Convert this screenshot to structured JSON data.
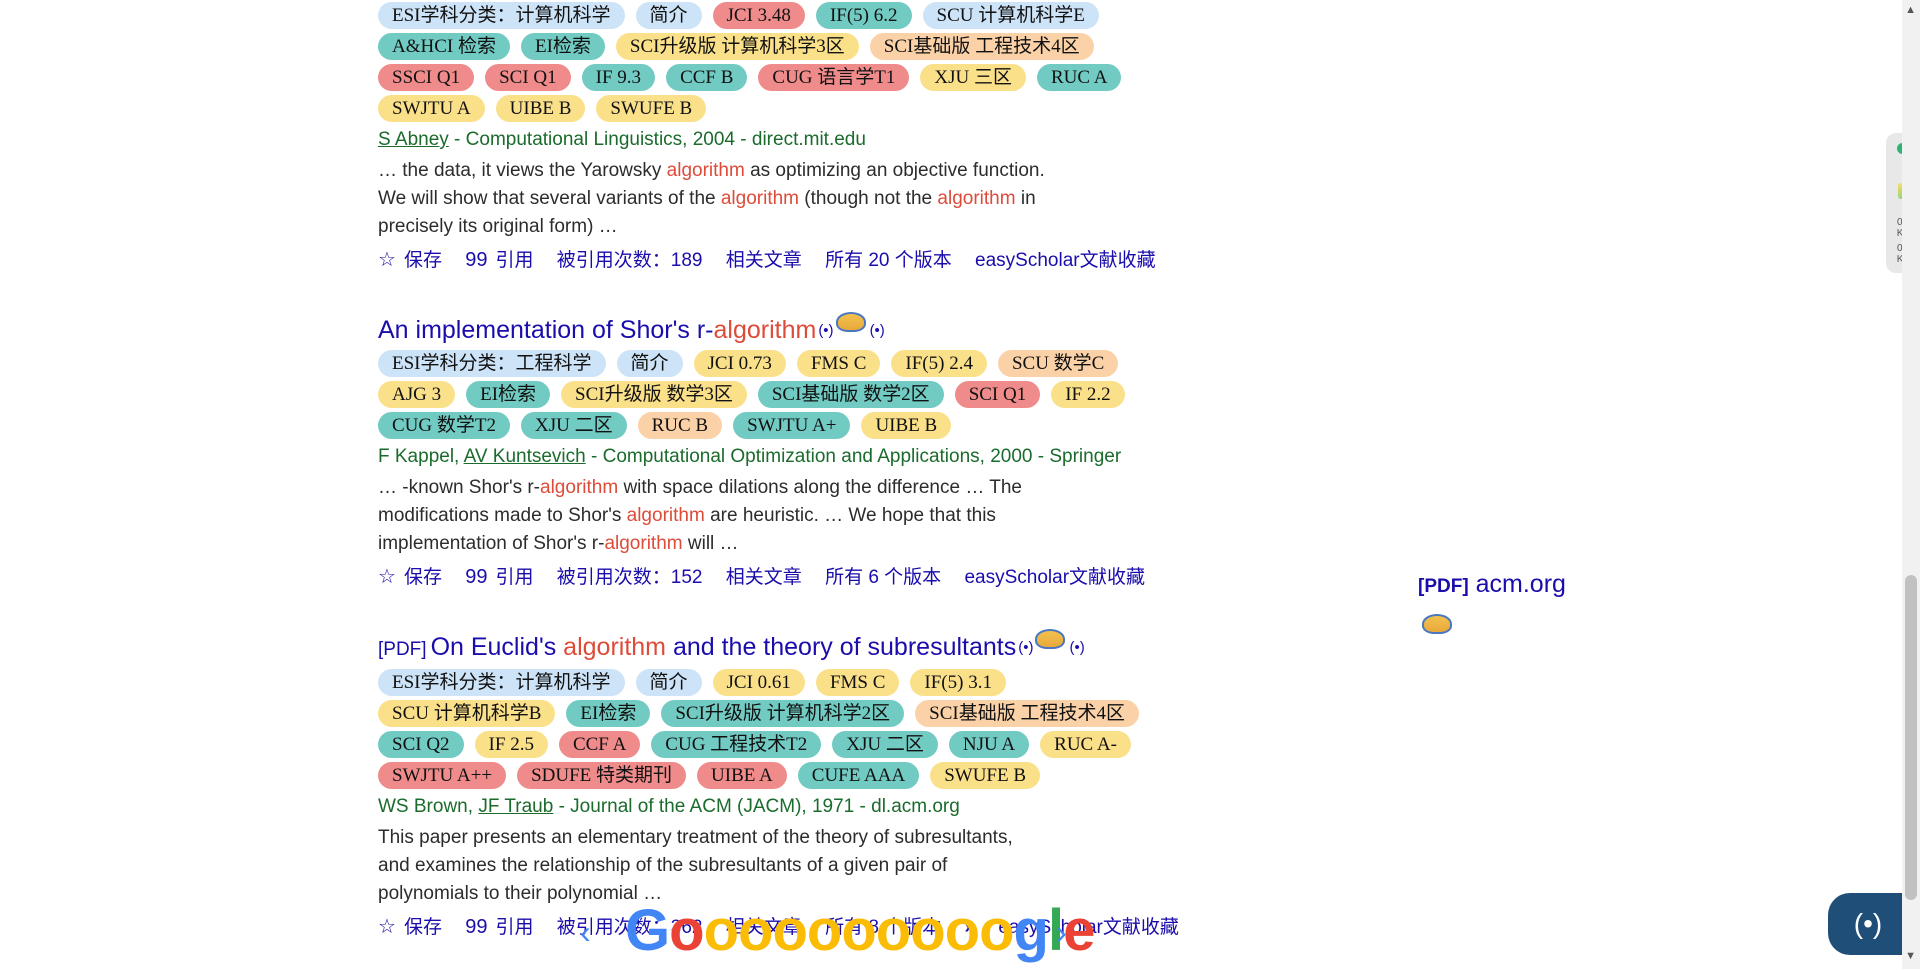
{
  "result1": {
    "badges": [
      {
        "text": "ESI学科分类：计算机科学",
        "color": "blue"
      },
      {
        "text": "简介",
        "color": "blue"
      },
      {
        "text": "JCI 3.48",
        "color": "red"
      },
      {
        "text": "IF(5) 6.2",
        "color": "teal"
      },
      {
        "text": "SCU 计算机科学E",
        "color": "blue"
      },
      {
        "text": "A&HCI 检索",
        "color": "teal"
      },
      {
        "text": "EI检索",
        "color": "teal"
      },
      {
        "text": "SCI升级版 计算机科学3区",
        "color": "yellow"
      },
      {
        "text": "SCI基础版 工程技术4区",
        "color": "orange"
      },
      {
        "text": "SSCI Q1",
        "color": "red"
      },
      {
        "text": "SCI Q1",
        "color": "red"
      },
      {
        "text": "IF 9.3",
        "color": "teal"
      },
      {
        "text": "CCF B",
        "color": "teal"
      },
      {
        "text": "CUG 语言学T1",
        "color": "red"
      },
      {
        "text": "XJU 三区",
        "color": "yellow"
      },
      {
        "text": "RUC A",
        "color": "teal"
      },
      {
        "text": "SWJTU A",
        "color": "yellow"
      },
      {
        "text": "UIBE B",
        "color": "yellow"
      },
      {
        "text": "SWUFE B",
        "color": "yellow"
      }
    ],
    "author": "S Abney",
    "meta_rest": " - Computational Linguistics, 2004 - direct.mit.edu",
    "snippet_parts": [
      "… the data, it views the Yarowsky ",
      "algorithm",
      " as optimizing an objective function. We will show that several variants of the ",
      "algorithm",
      " (though not the ",
      "algorithm",
      " in precisely its original form) …"
    ],
    "save": "保存",
    "cite": "引用",
    "cited_by": "被引用次数：189",
    "related": "相关文章",
    "versions": "所有 20 个版本",
    "easy": "easyScholar文献收藏"
  },
  "result2": {
    "title_pre": "An implementation of Shor's r-",
    "title_hl": "algorithm",
    "badges": [
      {
        "text": "ESI学科分类：工程科学",
        "color": "blue"
      },
      {
        "text": "简介",
        "color": "blue"
      },
      {
        "text": "JCI 0.73",
        "color": "yellow"
      },
      {
        "text": "FMS C",
        "color": "yellow"
      },
      {
        "text": "IF(5) 2.4",
        "color": "yellow"
      },
      {
        "text": "SCU 数学C",
        "color": "orange"
      },
      {
        "text": "AJG 3",
        "color": "yellow"
      },
      {
        "text": "EI检索",
        "color": "teal"
      },
      {
        "text": "SCI升级版 数学3区",
        "color": "yellow"
      },
      {
        "text": "SCI基础版 数学2区",
        "color": "teal"
      },
      {
        "text": "SCI Q1",
        "color": "red"
      },
      {
        "text": "IF 2.2",
        "color": "yellow"
      },
      {
        "text": "CUG 数学T2",
        "color": "teal"
      },
      {
        "text": "XJU 二区",
        "color": "teal"
      },
      {
        "text": "RUC B",
        "color": "orange"
      },
      {
        "text": "SWJTU A+",
        "color": "teal"
      },
      {
        "text": "UIBE B",
        "color": "yellow"
      }
    ],
    "author1": "F Kappel, ",
    "author2": "AV Kuntsevich",
    "meta_rest": " - Computational Optimization and Applications, 2000 - Springer",
    "snippet_parts": [
      "… -known Shor's r-",
      "algorithm",
      " with space dilations along the difference … The modifications made to Shor's ",
      "algorithm",
      " are heuristic. … We hope that this implementation of Shor's r-",
      "algorithm",
      " will …"
    ],
    "save": "保存",
    "cite": "引用",
    "cited_by": "被引用次数：152",
    "related": "相关文章",
    "versions": "所有 6 个版本",
    "easy": "easyScholar文献收藏"
  },
  "result3": {
    "pdf_tag": "[PDF]",
    "title_pre": "On Euclid's ",
    "title_hl": "algorithm",
    "title_post": " and the theory of subresultants",
    "badges": [
      {
        "text": "ESI学科分类：计算机科学",
        "color": "blue"
      },
      {
        "text": "简介",
        "color": "blue"
      },
      {
        "text": "JCI 0.61",
        "color": "yellow"
      },
      {
        "text": "FMS C",
        "color": "yellow"
      },
      {
        "text": "IF(5) 3.1",
        "color": "yellow"
      },
      {
        "text": "SCU 计算机科学B",
        "color": "yellow"
      },
      {
        "text": "EI检索",
        "color": "teal"
      },
      {
        "text": "SCI升级版 计算机科学2区",
        "color": "teal"
      },
      {
        "text": "SCI基础版 工程技术4区",
        "color": "orange"
      },
      {
        "text": "SCI Q2",
        "color": "teal"
      },
      {
        "text": "IF 2.5",
        "color": "yellow"
      },
      {
        "text": "CCF A",
        "color": "red"
      },
      {
        "text": "CUG 工程技术T2",
        "color": "teal"
      },
      {
        "text": "XJU 二区",
        "color": "teal"
      },
      {
        "text": "NJU A",
        "color": "teal"
      },
      {
        "text": "RUC A-",
        "color": "yellow"
      },
      {
        "text": "SWJTU A++",
        "color": "red"
      },
      {
        "text": "SDUFE 特类期刊",
        "color": "red"
      },
      {
        "text": "UIBE A",
        "color": "red"
      },
      {
        "text": "CUFE AAA",
        "color": "teal"
      },
      {
        "text": "SWUFE B",
        "color": "yellow"
      }
    ],
    "author1": "WS Brown, ",
    "author2": "JF Traub",
    "meta_rest": " - Journal of the ACM (JACM), 1971 - dl.acm.org",
    "snippet": "This paper presents an elementary treatment of the theory of subresultants, and examines the relationship of the subresultants of a given pair of polynomials to their polynomial …",
    "save": "保存",
    "cite": "引用",
    "cited_by": "被引用次数：362",
    "related": "相关文章",
    "versions": "所有 8 个版本",
    "easy": "easyScholar文献收藏",
    "side_pdf_tag": "[PDF]",
    "side_pdf_site": "acm.org"
  },
  "pager": {
    "letters": [
      "G",
      "o",
      "o",
      "o",
      "o",
      "o",
      "o",
      "o",
      "o",
      "o",
      "o",
      "g",
      "l",
      "e"
    ],
    "prev": "‹",
    "next": "›"
  },
  "netpanel": {
    "up": "0.1",
    "up_unit": "K/s",
    "down": "0.4",
    "down_unit": "K/s"
  },
  "icons": {
    "star": "☆",
    "cite": "99",
    "radio": "(•)",
    "more": "»"
  }
}
